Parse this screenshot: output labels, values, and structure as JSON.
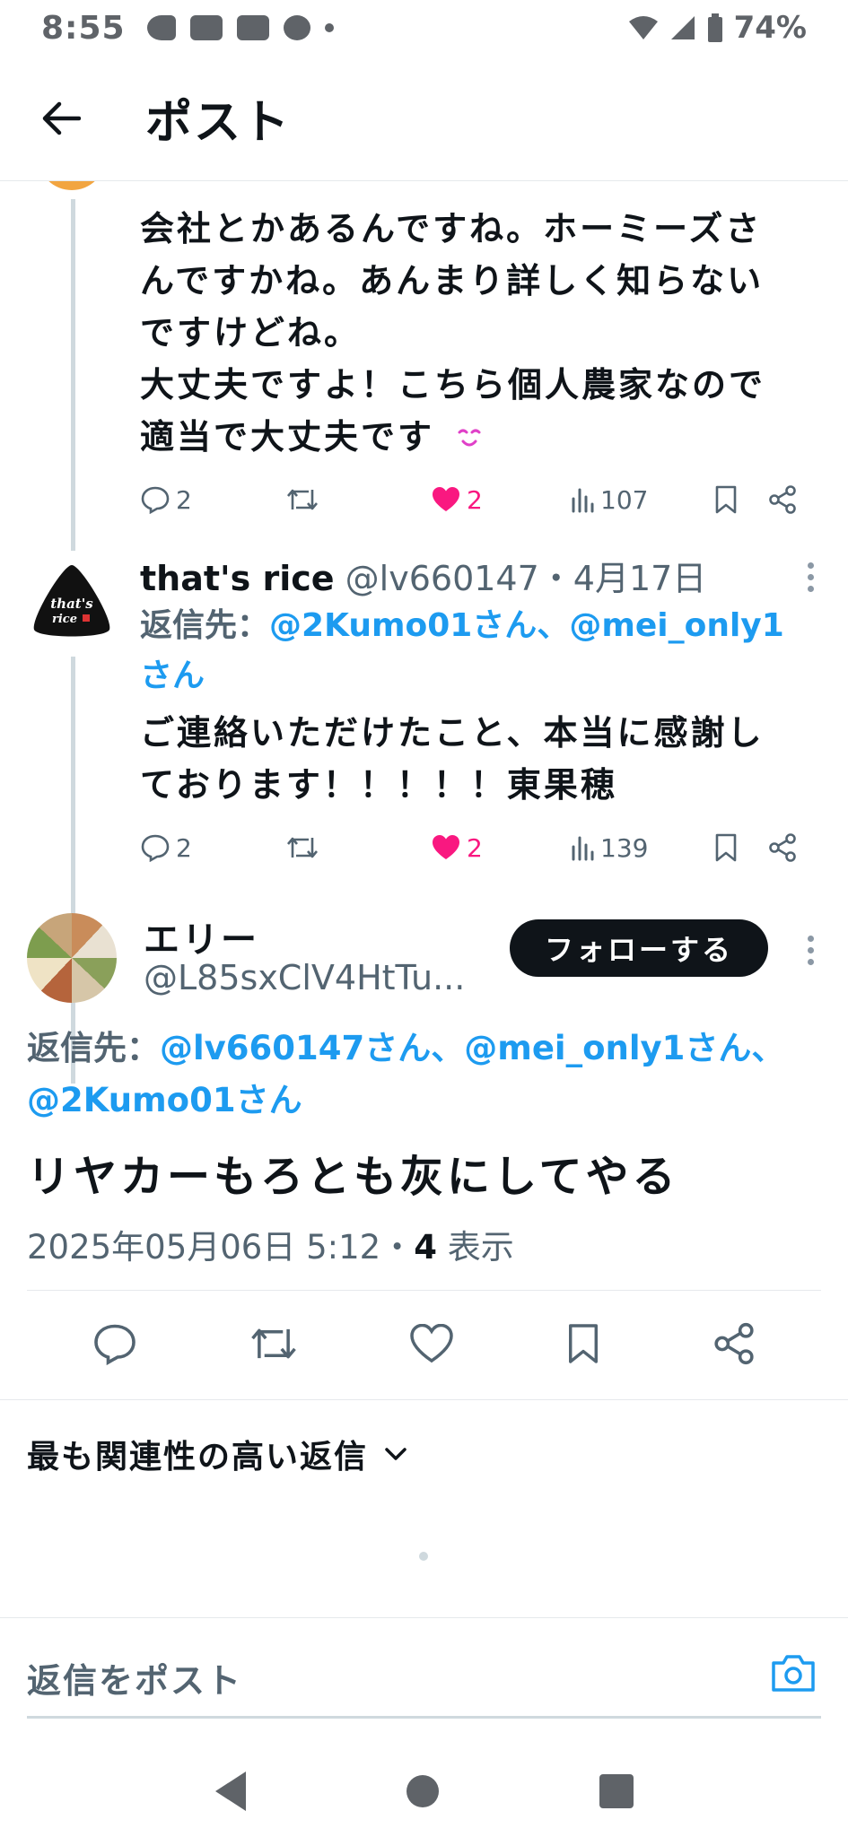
{
  "status_bar": {
    "time": "8:55",
    "battery": "74%"
  },
  "header": {
    "title": "ポスト"
  },
  "reply_1": {
    "text_lines": [
      "会社とかあるんですね。ホーミーズさ",
      "んですかね。あんまり詳しく知らない",
      "ですけどね。",
      "大丈夫ですよ！こちら個人農家なので",
      "適当で大丈夫です"
    ],
    "emoji": "😌",
    "replies": "2",
    "likes": "2",
    "views": "107"
  },
  "reply_2": {
    "name": "that's rice",
    "handle": "@lv660147",
    "date": "・4月17日",
    "replying_prefix": "返信先：",
    "mention_1": "@2Kumo01さん",
    "separator": "、",
    "mention_2": "@mei_only1",
    "mention_2_suffix": "さん",
    "text_lines": [
      "ご連絡いただけたこと、本当に感謝し",
      "ております！！！！！東果穂"
    ],
    "replies": "2",
    "likes": "2",
    "views": "139",
    "avatar_text": "that's rice"
  },
  "main_tweet": {
    "name": "エリー",
    "handle": "@L85sxClV4HtTu...",
    "follow_label": "フォローする",
    "replying_prefix": "返信先：",
    "mention_1": "@lv660147さん",
    "mention_2": "@mei_only1さん",
    "mention_3": "@2Kumo01さん",
    "separator": "、",
    "text": "リヤカーもろとも灰にしてやる",
    "datetime": "2025年05月06日 5:12・",
    "views_count": "4",
    "views_label": "表示"
  },
  "sort": {
    "label": "最も関連性の高い返信"
  },
  "reply_input": {
    "placeholder": "返信をポスト"
  },
  "colors": {
    "accent": "#1d9bf0",
    "like": "#f91880",
    "text": "#0f1419",
    "muted": "#536471"
  }
}
